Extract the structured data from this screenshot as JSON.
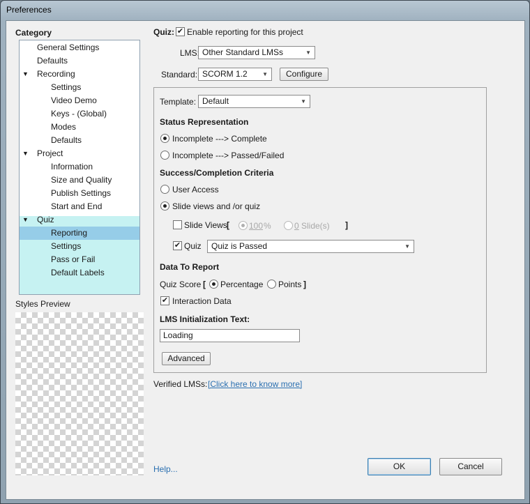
{
  "window": {
    "title": "Preferences"
  },
  "category": {
    "title": "Category",
    "items": [
      {
        "label": "General Settings",
        "level": 1,
        "expander": ""
      },
      {
        "label": "Defaults",
        "level": 1,
        "expander": ""
      },
      {
        "label": "Recording",
        "level": 0,
        "expander": "▼"
      },
      {
        "label": "Settings",
        "level": 2,
        "expander": ""
      },
      {
        "label": "Video Demo",
        "level": 2,
        "expander": ""
      },
      {
        "label": "Keys - (Global)",
        "level": 2,
        "expander": ""
      },
      {
        "label": "Modes",
        "level": 2,
        "expander": ""
      },
      {
        "label": "Defaults",
        "level": 2,
        "expander": ""
      },
      {
        "label": "Project",
        "level": 0,
        "expander": "▼"
      },
      {
        "label": "Information",
        "level": 2,
        "expander": ""
      },
      {
        "label": "Size and Quality",
        "level": 2,
        "expander": ""
      },
      {
        "label": "Publish Settings",
        "level": 2,
        "expander": ""
      },
      {
        "label": "Start and End",
        "level": 2,
        "expander": ""
      },
      {
        "label": "Quiz",
        "level": 0,
        "expander": "▼"
      },
      {
        "label": "Reporting",
        "level": 2,
        "expander": "",
        "selected": true
      },
      {
        "label": "Settings",
        "level": 2,
        "expander": ""
      },
      {
        "label": "Pass or Fail",
        "level": 2,
        "expander": ""
      },
      {
        "label": "Default Labels",
        "level": 2,
        "expander": ""
      }
    ]
  },
  "styles_preview": {
    "title": "Styles Preview"
  },
  "quiz": {
    "label": "Quiz:",
    "enable_reporting_label": "Enable reporting for this project",
    "enable_reporting_checked": true
  },
  "lms": {
    "label": "LMS:",
    "value": "Other Standard LMSs"
  },
  "standard": {
    "label": "Standard:",
    "value": "SCORM 1.2",
    "configure_label": "Configure"
  },
  "template": {
    "label": "Template:",
    "value": "Default"
  },
  "status_representation": {
    "heading": "Status Representation",
    "option_complete": "Incomplete ---> Complete",
    "option_passed_failed": "Incomplete ---> Passed/Failed",
    "selected": "complete"
  },
  "criteria": {
    "heading": "Success/Completion Criteria",
    "user_access_label": "User Access",
    "slide_views_quiz_label": "Slide views and /or quiz",
    "selected": "slide_views_quiz",
    "slide_views_label": "Slide Views",
    "slide_views_checked": false,
    "bracket_open": "[",
    "bracket_close": "]",
    "percent_value": "100",
    "percent_unit": "%",
    "slides_value": "0",
    "slides_unit": "Slide(s)",
    "quiz_label": "Quiz",
    "quiz_checked": true,
    "quiz_value": "Quiz is Passed"
  },
  "data_to_report": {
    "heading": "Data To Report",
    "quiz_score_label": "Quiz Score",
    "bracket_open": "[",
    "bracket_close": "]",
    "percentage_label": "Percentage",
    "points_label": "Points",
    "selected": "percentage",
    "interaction_data_label": "Interaction Data",
    "interaction_data_checked": true
  },
  "lms_init": {
    "heading": "LMS Initialization Text:",
    "value": "Loading"
  },
  "advanced_label": "Advanced",
  "verified": {
    "label": "Verified LMSs:",
    "link_text": "[Click here to know more]"
  },
  "footer": {
    "help_label": "Help...",
    "ok_label": "OK",
    "cancel_label": "Cancel"
  },
  "icons": {
    "checkmark": "check-icon",
    "expander": "triangle-down-icon",
    "dropdown": "dropdown-arrow-icon"
  },
  "colors": {
    "selection": "#96cde8",
    "quiz_highlight": "#c6f2f2",
    "link": "#2a6fb0"
  }
}
